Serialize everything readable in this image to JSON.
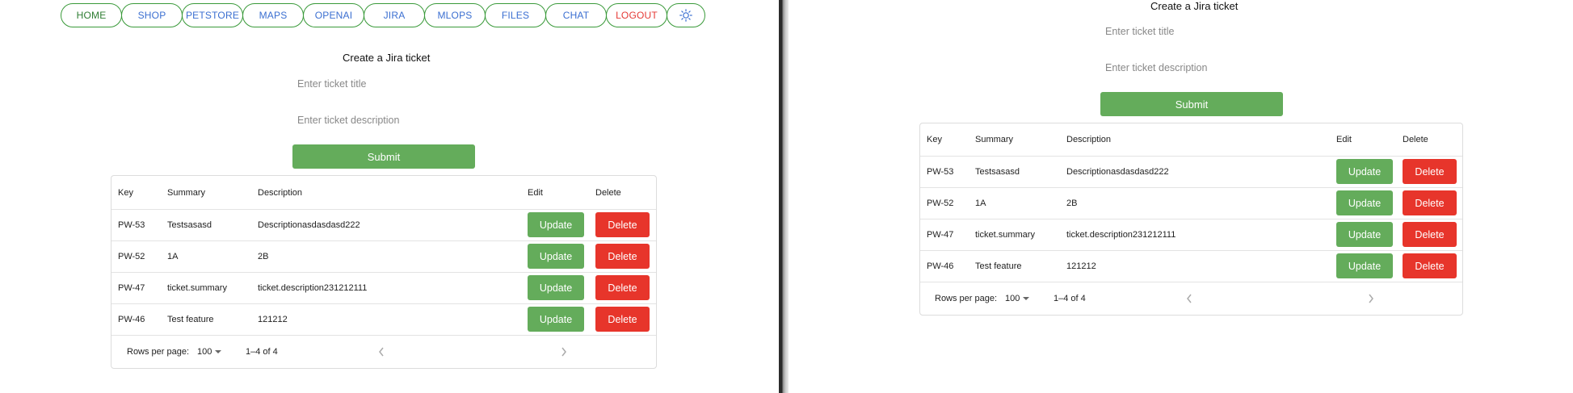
{
  "nav": {
    "home": "HOME",
    "shop": "SHOP",
    "petstore": "PETSTORE",
    "maps": "MAPS",
    "openai": "OPENAI",
    "jira": "JIRA",
    "mlops": "MLOPS",
    "files": "FILES",
    "chat": "CHAT",
    "logout": "LOGOUT"
  },
  "form": {
    "title": "Create a Jira ticket",
    "title_placeholder": "Enter ticket title",
    "description_placeholder": "Enter ticket description",
    "submit": "Submit"
  },
  "table": {
    "headers": {
      "key": "Key",
      "summary": "Summary",
      "description": "Description",
      "edit": "Edit",
      "delete": "Delete"
    },
    "rows": [
      {
        "key": "PW-53",
        "summary": "Testsasasd",
        "description": "Descriptionasdasdasd222"
      },
      {
        "key": "PW-52",
        "summary": "1A",
        "description": "2B"
      },
      {
        "key": "PW-47",
        "summary": "ticket.summary",
        "description": "ticket.description231212111"
      },
      {
        "key": "PW-46",
        "summary": "Test feature",
        "description": "121212"
      }
    ],
    "update_label": "Update",
    "delete_label": "Delete",
    "pagination": {
      "rows_per_page_label": "Rows per page:",
      "rows_per_page_value": "100",
      "range": "1–4 of 4"
    }
  },
  "colors": {
    "green": "#64ac5b",
    "red": "#e7352b",
    "nav_blue": "#3b6fd1",
    "nav_border": "#3a9a3a"
  },
  "icons": {
    "theme_toggle": "sun-icon",
    "dropdown": "caret-down-icon",
    "prev": "chevron-left-icon",
    "next": "chevron-right-icon"
  }
}
